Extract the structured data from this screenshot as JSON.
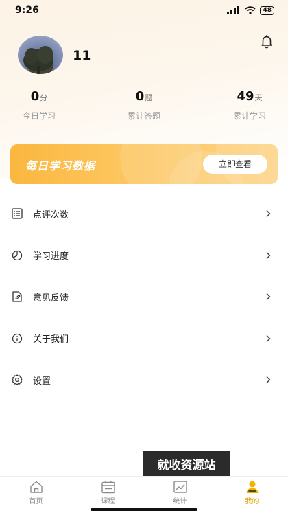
{
  "status_bar": {
    "time": "9:26",
    "battery": "48"
  },
  "profile": {
    "username": "11"
  },
  "stats": [
    {
      "value": "0",
      "unit": "分",
      "label": "今日学习"
    },
    {
      "value": "0",
      "unit": "题",
      "label": "累计答题"
    },
    {
      "value": "49",
      "unit": "天",
      "label": "累计学习"
    }
  ],
  "banner": {
    "title": "每日学习数据",
    "button_label": "立即查看"
  },
  "menu": [
    {
      "label": "点评次数"
    },
    {
      "label": "学习进度"
    },
    {
      "label": "意见反馈"
    },
    {
      "label": "关于我们"
    },
    {
      "label": "设置"
    }
  ],
  "watermark": "就收资源站",
  "tabs": [
    {
      "label": "首页"
    },
    {
      "label": "课程"
    },
    {
      "label": "统计"
    },
    {
      "label": "我的"
    }
  ],
  "colors": {
    "accent": "#e6a100",
    "banner": "#fbb73f"
  }
}
